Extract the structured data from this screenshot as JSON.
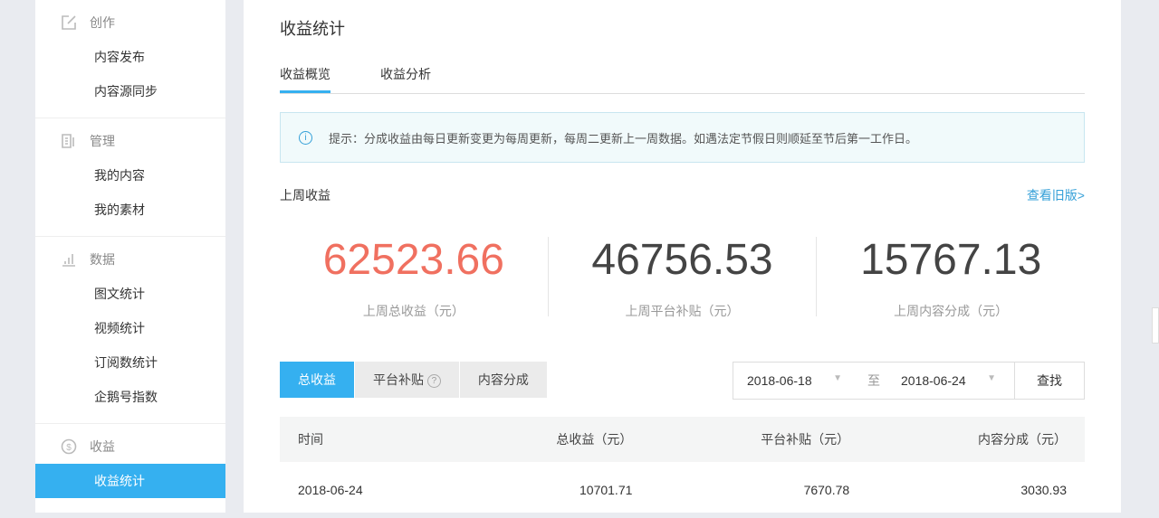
{
  "sidebar": {
    "groups": [
      {
        "label": "创作",
        "icon": "edit-icon",
        "items": [
          "内容发布",
          "内容源同步"
        ]
      },
      {
        "label": "管理",
        "icon": "document-icon",
        "items": [
          "我的内容",
          "我的素材"
        ]
      },
      {
        "label": "数据",
        "icon": "bar-chart-icon",
        "items": [
          "图文统计",
          "视频统计",
          "订阅数统计",
          "企鹅号指数"
        ]
      },
      {
        "label": "收益",
        "icon": "dollar-icon",
        "items": [
          "收益统计"
        ]
      }
    ]
  },
  "page": {
    "title": "收益统计",
    "tabs": [
      "收益概览",
      "收益分析"
    ],
    "notice": "提示：分成收益由每日更新变更为每周更新，每周二更新上一周数据。如遇法定节假日则顺延至节后第一工作日。",
    "section": "上周收益",
    "old_link": "查看旧版>",
    "stats": [
      {
        "value": "62523.66",
        "label": "上周总收益（元）",
        "color": "#f07060"
      },
      {
        "value": "46756.53",
        "label": "上周平台补贴（元）"
      },
      {
        "value": "15767.13",
        "label": "上周内容分成（元）"
      }
    ],
    "filters": [
      "总收益",
      "平台补贴",
      "内容分成"
    ],
    "date_from": "2018-06-18",
    "to": "至",
    "date_to": "2018-06-24",
    "search": "查找",
    "table": {
      "headers": [
        "时间",
        "总收益（元）",
        "平台补贴（元）",
        "内容分成（元）"
      ],
      "rows": [
        [
          "2018-06-24",
          "10701.71",
          "7670.78",
          "3030.93"
        ]
      ]
    }
  }
}
